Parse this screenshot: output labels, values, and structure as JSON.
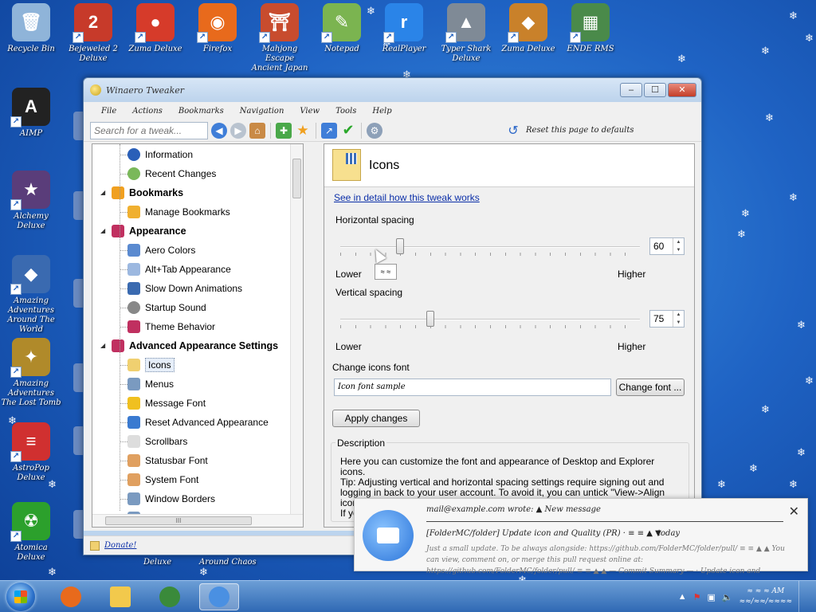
{
  "desktop": {
    "icons": [
      {
        "label": "Recycle Bin",
        "color": "#8fb4d9",
        "glyph": "🗑"
      },
      {
        "label": "Bejeweled 2 Deluxe",
        "color": "#c73a2a",
        "glyph": "2"
      },
      {
        "label": "Zuma Deluxe",
        "color": "#d63b2a",
        "glyph": "●"
      },
      {
        "label": "Firefox",
        "color": "#e86a1c",
        "glyph": "◉"
      },
      {
        "label": "Mahjong Escape Ancient Japan",
        "color": "#c84c2e",
        "glyph": "⛩"
      },
      {
        "label": "Notepad",
        "color": "#7bb450",
        "glyph": "✎"
      },
      {
        "label": "RealPlayer",
        "color": "#2a84e8",
        "glyph": "r"
      },
      {
        "label": "Typer Shark Deluxe",
        "color": "#7f8a96",
        "glyph": "▲"
      },
      {
        "label": "Zuma Deluxe",
        "color": "#c9812a",
        "glyph": "◆"
      },
      {
        "label": "ENDE RMS",
        "color": "#4a8a4a",
        "glyph": "▦"
      },
      {
        "label": "AIMP",
        "color": "#222222",
        "glyph": "A"
      },
      {
        "label": "Alchemy Deluxe",
        "color": "#5a3d7a",
        "glyph": "★"
      },
      {
        "label": "Amazing Adventures Around The World",
        "color": "#3a6ab0",
        "glyph": "◆"
      },
      {
        "label": "Amazing Adventures The Lost Tomb",
        "color": "#b08a2a",
        "glyph": "✦"
      },
      {
        "label": "AstroPop Deluxe",
        "color": "#d03030",
        "glyph": "≡"
      },
      {
        "label": "Atomica Deluxe",
        "color": "#2ca02c",
        "glyph": "☢"
      }
    ],
    "bottom_labels": [
      "Deluxe",
      "Around Chaos"
    ]
  },
  "window": {
    "title": "Winaero Tweaker",
    "menu": [
      "File",
      "Actions",
      "Bookmarks",
      "Navigation",
      "View",
      "Tools",
      "Help"
    ],
    "search_placeholder": "Search for a tweak...",
    "reset_label": "Reset this page to defaults",
    "tree": [
      {
        "label": "Information",
        "type": "item",
        "icon": "info-icon",
        "color": "#2a5fb8"
      },
      {
        "label": "Recent Changes",
        "type": "item",
        "icon": "recent-icon",
        "color": "#7ab85a"
      },
      {
        "label": "Bookmarks",
        "type": "cat",
        "icon": "star-icon",
        "color": "#f0a020"
      },
      {
        "label": "Manage Bookmarks",
        "type": "item",
        "icon": "star-icon",
        "color": "#f0b030"
      },
      {
        "label": "Appearance",
        "type": "cat",
        "icon": "palette-icon",
        "color": "#c03060"
      },
      {
        "label": "Aero Colors",
        "type": "item",
        "icon": "aero-icon",
        "color": "#5a8ad0"
      },
      {
        "label": "Alt+Tab Appearance",
        "type": "item",
        "icon": "window-icon",
        "color": "#9cb8e0"
      },
      {
        "label": "Slow Down Animations",
        "type": "item",
        "icon": "anim-icon",
        "color": "#3a6ab0"
      },
      {
        "label": "Startup Sound",
        "type": "item",
        "icon": "sound-icon",
        "color": "#888888"
      },
      {
        "label": "Theme Behavior",
        "type": "item",
        "icon": "theme-icon",
        "color": "#c03060"
      },
      {
        "label": "Advanced Appearance Settings",
        "type": "cat",
        "icon": "palette-icon",
        "color": "#c03060"
      },
      {
        "label": "Icons",
        "type": "item",
        "icon": "folder-icon",
        "color": "#f0d070",
        "selected": true
      },
      {
        "label": "Menus",
        "type": "item",
        "icon": "menu-icon",
        "color": "#7a9ac0"
      },
      {
        "label": "Message Font",
        "type": "item",
        "icon": "warning-icon",
        "color": "#f0c020"
      },
      {
        "label": "Reset Advanced Appearance",
        "type": "item",
        "icon": "reset-icon",
        "color": "#3a7ad0"
      },
      {
        "label": "Scrollbars",
        "type": "item",
        "icon": "scroll-icon",
        "color": "#dddddd"
      },
      {
        "label": "Statusbar Font",
        "type": "item",
        "icon": "font-icon",
        "color": "#e0a060"
      },
      {
        "label": "System Font",
        "type": "item",
        "icon": "font-icon",
        "color": "#e0a060"
      },
      {
        "label": "Window Borders",
        "type": "item",
        "icon": "border-icon",
        "color": "#7a9ac0"
      },
      {
        "label": "Window Title Bars",
        "type": "item",
        "icon": "titlebar-icon",
        "color": "#7a9ac0"
      }
    ],
    "hscroll_grip": "III",
    "panel": {
      "title": "Icons",
      "detail_link": "See in detail how this tweak works",
      "horizontal_label": "Horizontal spacing",
      "horizontal_value": "60",
      "horizontal_fraction": 0.2,
      "vertical_label": "Vertical spacing",
      "vertical_value": "75",
      "vertical_fraction": 0.3,
      "lower": "Lower",
      "higher": "Higher",
      "font_label": "Change icons font",
      "font_sample": "Icon font sample",
      "change_font_btn": "Change font ...",
      "apply_btn": "Apply changes",
      "desc_title": "Description",
      "desc_text": "Here you can customize the font and appearance of Desktop and Explorer icons.\nTip: Adjusting vertical and horizontal spacing settings require signing out and logging in back to your user account. To avoid it, you can untick \"View->Align icons to grid\" in the Desktop context menu and then tick it back.\nIf yo"
    },
    "status_link": "Donate!",
    "tooltip": "≈ ≈"
  },
  "notification": {
    "from": "mail@example.com wrote: ▲ New message",
    "subject": "[FolderMC/folder] Update icon and Quality (PR) · ≡ ≡ ▲ ▼",
    "time": "today",
    "body": "Just a small update. To be always alongside: https://github.com/FolderMC/folder/pull/ ≡ ≡ ▲ ▲ You can view, comment on, or merge this pull request online at: https://github.com/FolderMC/folder/pull/ ≡ ≡ ▲ ▲ — Commit Summary — · Update icon and"
  },
  "taskbar": {
    "apps": [
      {
        "name": "firefox",
        "color": "#e86a1c"
      },
      {
        "name": "explorer",
        "color": "#f2c94c"
      },
      {
        "name": "chrome",
        "color": "#3a8a3a"
      },
      {
        "name": "thunderbird",
        "color": "#4a90e2"
      }
    ],
    "clock_time": "≈ ≈ ≈ AM",
    "clock_date": "≈≈/≈≈/≈≈≈≈"
  }
}
